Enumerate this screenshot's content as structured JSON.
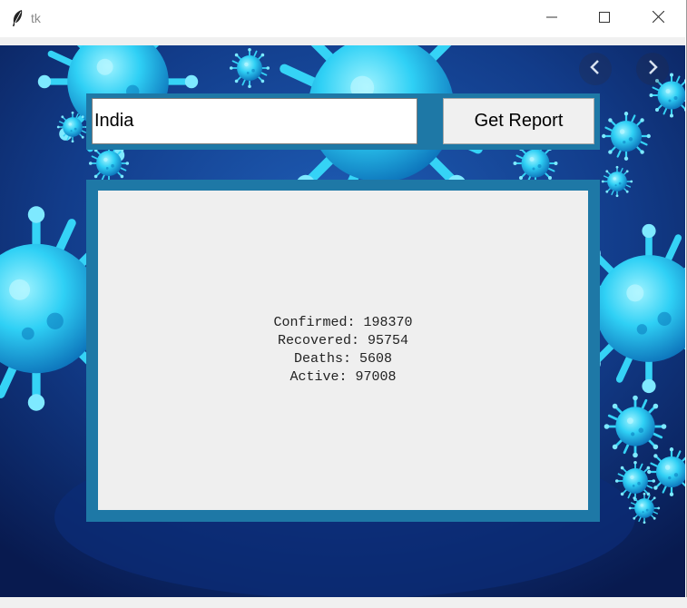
{
  "window": {
    "title": "tk",
    "icons": {
      "app": "feather-icon",
      "minimize": "minimize-icon",
      "maximize": "maximize-icon",
      "close": "close-icon"
    }
  },
  "background": {
    "image": "coronavirus-illustration",
    "nav_icons": [
      "chevron-left-icon",
      "chevron-right-icon"
    ]
  },
  "search": {
    "value": "India",
    "button_label": "Get Report"
  },
  "report": {
    "lines": [
      "Confirmed: 198370",
      "Recovered: 95754",
      "Deaths: 5608",
      "Active: 97008"
    ]
  },
  "colors": {
    "frame": "#1e78a6",
    "panel": "#efefef",
    "background_dark": "#0a1f5c",
    "virus": "#26c6f0"
  }
}
